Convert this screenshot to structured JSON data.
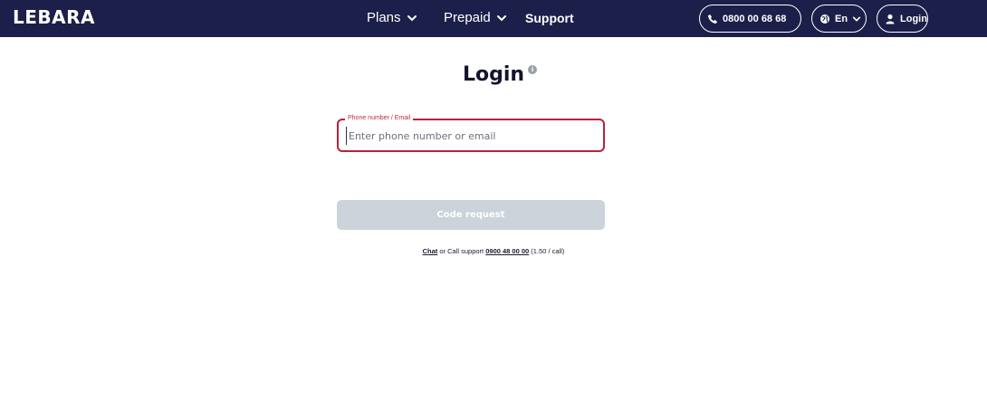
{
  "header": {
    "logo": "LEBARA",
    "nav": [
      {
        "label": "Plans",
        "has_dropdown": true
      },
      {
        "label": "Prepaid",
        "has_dropdown": true
      },
      {
        "label": "Support",
        "has_dropdown": false
      }
    ],
    "phone": "0800 00 68 68",
    "language": "En",
    "login": "Login"
  },
  "main": {
    "title": "Login",
    "info_icon": "info-icon",
    "field": {
      "legend": "Phone number / Email",
      "placeholder": "Enter phone number or email",
      "value": ""
    },
    "cta": "Code request",
    "support": {
      "chat": "Chat",
      "or_call": " or Call support ",
      "number": "0900 48 00 00",
      "rate": " (1.50 / call)"
    }
  },
  "colors": {
    "header_bg": "#1c1f4a",
    "field_border": "#b8223a",
    "button_disabled": "#cdd3da"
  }
}
